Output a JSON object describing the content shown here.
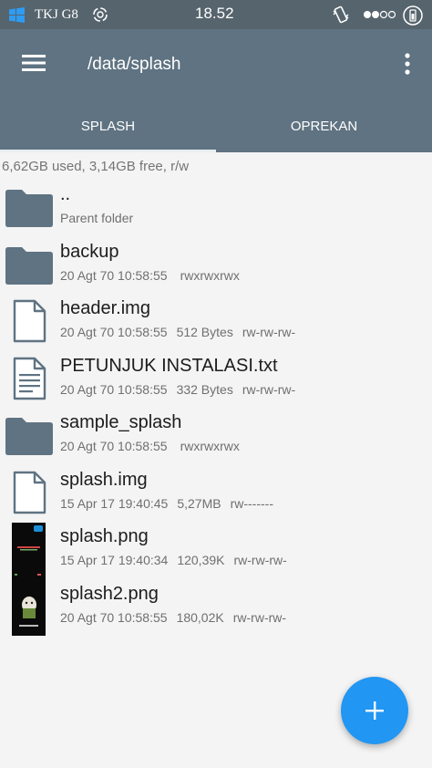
{
  "status_bar": {
    "carrier": "TKJ G8",
    "time": "18.52"
  },
  "app_bar": {
    "path": "/data/splash"
  },
  "tabs": [
    {
      "label": "SPLASH",
      "active": true
    },
    {
      "label": "OPREKAN",
      "active": false
    }
  ],
  "storage_info": "6,62GB used, 3,14GB free, r/w",
  "files": [
    {
      "name": "..",
      "date": "Parent folder",
      "size": "",
      "perms": "",
      "icon": "folder-icon"
    },
    {
      "name": "backup",
      "date": "20 Agt 70 10:58:55",
      "size": "",
      "perms": "rwxrwxrwx",
      "icon": "folder-icon"
    },
    {
      "name": "header.img",
      "date": "20 Agt 70 10:58:55",
      "size": "512 Bytes",
      "perms": "rw-rw-rw-",
      "icon": "file-icon"
    },
    {
      "name": "PETUNJUK INSTALASI.txt",
      "date": "20 Agt 70 10:58:55",
      "size": "332 Bytes",
      "perms": "rw-rw-rw-",
      "icon": "text-file-icon"
    },
    {
      "name": "sample_splash",
      "date": "20 Agt 70 10:58:55",
      "size": "",
      "perms": "rwxrwxrwx",
      "icon": "folder-icon"
    },
    {
      "name": "splash.img",
      "date": "15 Apr 17 19:40:45",
      "size": "5,27MB",
      "perms": "rw-------",
      "icon": "file-icon"
    },
    {
      "name": "splash.png",
      "date": "15 Apr 17 19:40:34",
      "size": "120,39K",
      "perms": "rw-rw-rw-",
      "icon": "image-thumbnail"
    },
    {
      "name": "splash2.png",
      "date": "20 Agt 70 10:58:55",
      "size": "180,02K",
      "perms": "rw-rw-rw-",
      "icon": "image-thumbnail"
    }
  ],
  "colors": {
    "status_bar": "#56646d",
    "app_bar": "#5f7382",
    "folder": "#5f7382",
    "fab": "#2196f3"
  }
}
